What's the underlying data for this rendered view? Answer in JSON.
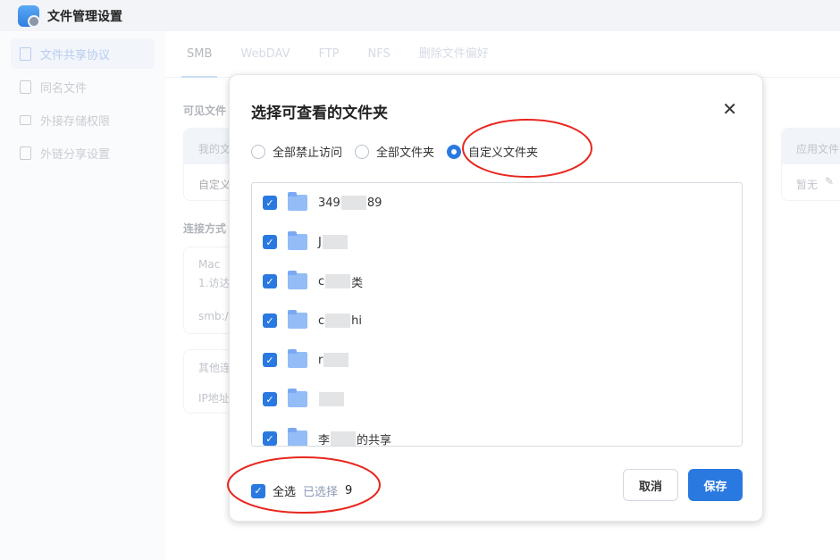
{
  "app": {
    "title": "文件管理设置"
  },
  "sidebar": {
    "items": [
      {
        "label": "文件共享协议",
        "active": true
      },
      {
        "label": "同名文件"
      },
      {
        "label": "外接存储权限"
      },
      {
        "label": "外链分享设置"
      }
    ]
  },
  "tabs": [
    {
      "label": "SMB",
      "active": true
    },
    {
      "label": "WebDAV"
    },
    {
      "label": "FTP"
    },
    {
      "label": "NFS"
    },
    {
      "label": "删除文件偏好"
    }
  ],
  "background": {
    "visible_folders": "可见文件",
    "my_files": "我的文",
    "custom": "自定义",
    "connect": "连接方式",
    "mac": "Mac",
    "mac_step": "1.访达",
    "smb": "smb:/",
    "other": "其他连",
    "ip": "IP地址",
    "app_files": "应用文件",
    "none": "暂无"
  },
  "dialog": {
    "title": "选择可查看的文件夹",
    "radios": [
      {
        "label": "全部禁止访问",
        "selected": false
      },
      {
        "label": "全部文件夹",
        "selected": false
      },
      {
        "label": "自定义文件夹",
        "selected": true
      }
    ],
    "folders": [
      {
        "prefix": "349",
        "suffix": "89"
      },
      {
        "prefix": "J",
        "suffix": ""
      },
      {
        "prefix": "c",
        "suffix": "类"
      },
      {
        "prefix": "c",
        "suffix": "hi"
      },
      {
        "prefix": "r",
        "suffix": ""
      },
      {
        "prefix": "",
        "suffix": ""
      },
      {
        "prefix": "李",
        "suffix": "的共享"
      }
    ],
    "select_all": "全选",
    "selected_label": "已选择",
    "selected_count": "9",
    "cancel": "取消",
    "save": "保存"
  },
  "colors": {
    "accent": "#2a79e0",
    "annotation": "#e8261e"
  }
}
